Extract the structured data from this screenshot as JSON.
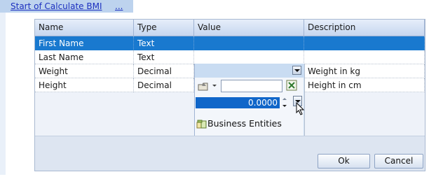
{
  "header": {
    "link_text": "Start of Calculate BMI",
    "more_text": "..."
  },
  "grid": {
    "columns": [
      "Name",
      "Type",
      "Value",
      "Description"
    ],
    "rows": [
      {
        "name": "First Name",
        "type": "Text",
        "value": "",
        "description": ""
      },
      {
        "name": "Last Name",
        "type": "Text",
        "value": "",
        "description": ""
      },
      {
        "name": "Weight",
        "type": "Decimal",
        "value": "",
        "description": "Weight in kg"
      },
      {
        "name": "Height",
        "type": "Decimal",
        "value": "",
        "description": "Height in cm"
      }
    ]
  },
  "editor": {
    "reference_value": "",
    "number_value": "0.0000",
    "menu_item": "Business Entities"
  },
  "buttons": {
    "ok": "Ok",
    "cancel": "Cancel"
  },
  "colors": {
    "selection": "#1979cf",
    "header": "#c6d6ef",
    "panel": "#c9dcf2"
  }
}
